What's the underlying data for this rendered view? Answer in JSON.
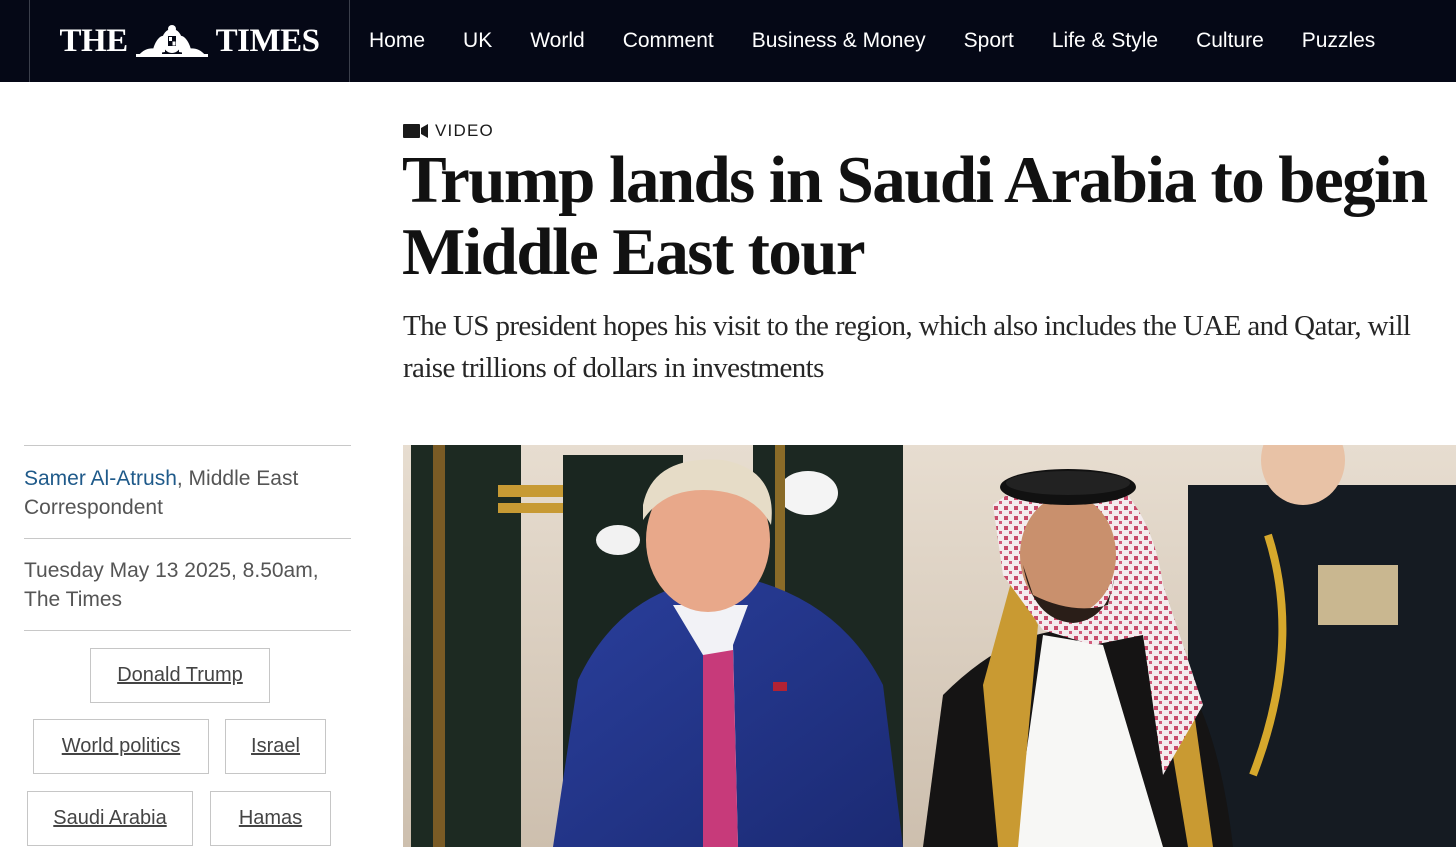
{
  "header": {
    "logo": {
      "left": "THE",
      "right": "TIMES",
      "crest_icon": "royal-crest-icon"
    },
    "nav": [
      "Home",
      "UK",
      "World",
      "Comment",
      "Business & Money",
      "Sport",
      "Life & Style",
      "Culture",
      "Puzzles"
    ]
  },
  "article": {
    "kicker": {
      "icon": "video-camera-icon",
      "label": "VIDEO"
    },
    "headline": "Trump lands in Saudi Arabia to begin Middle East tour",
    "standfirst": "The US president hopes his visit to the region, which also includes the UAE and Qatar, will raise trillions of dollars in investments",
    "byline": {
      "author": "Samer Al-Atrush",
      "role": ", Middle East Correspondent"
    },
    "dateline": "Tuesday May 13 2025, 8.50am, The Times",
    "tags": [
      "Donald Trump",
      "World politics",
      "Israel",
      "Saudi Arabia",
      "Hamas"
    ]
  },
  "colors": {
    "nav_background": "#050816",
    "author_link": "#1f5a8a",
    "text_dark": "#111111"
  }
}
